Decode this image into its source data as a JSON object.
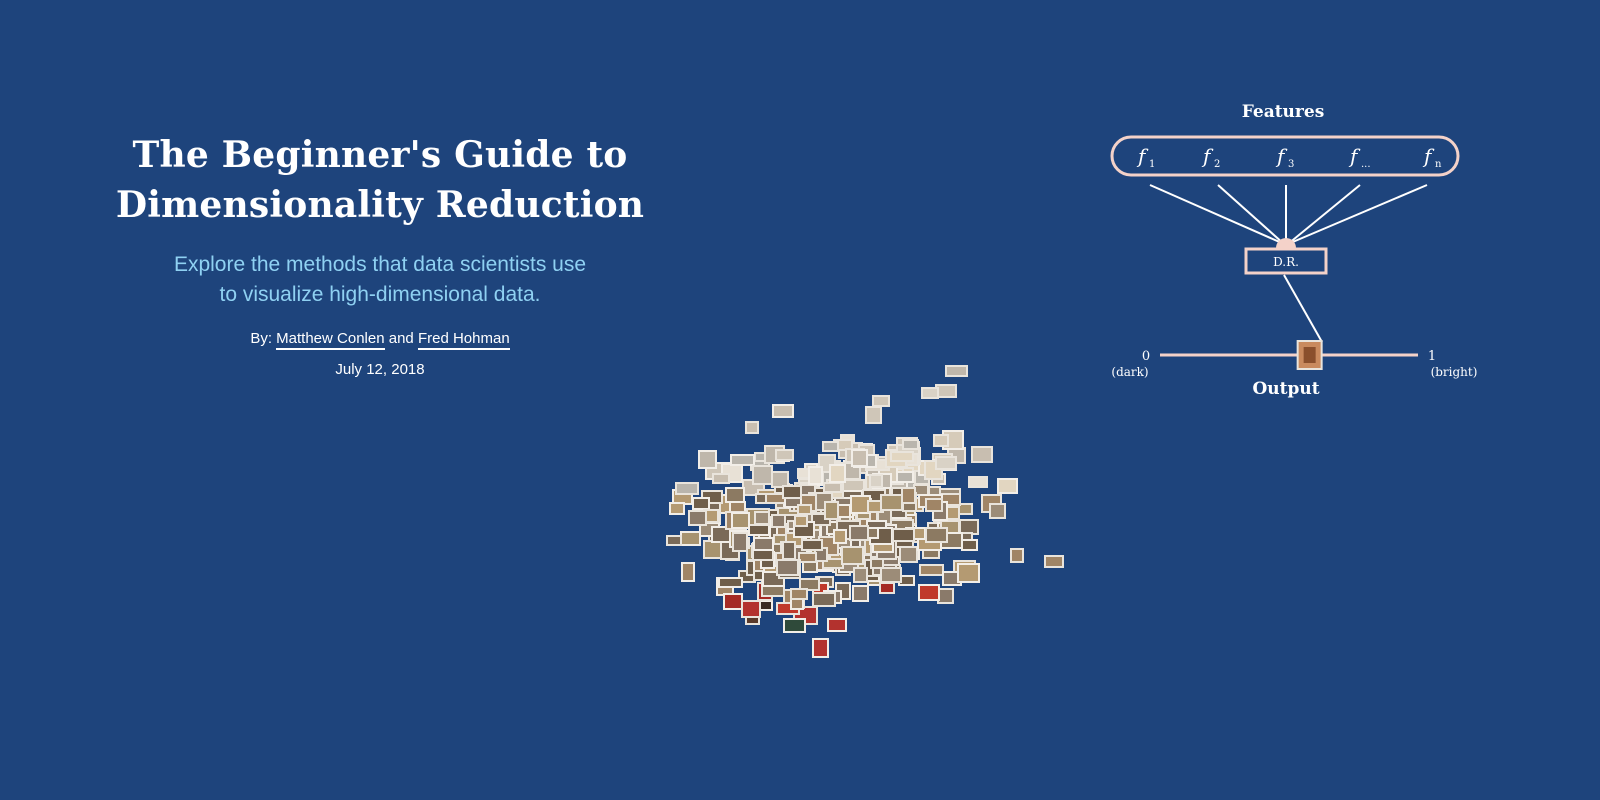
{
  "hero": {
    "title_line1": "The Beginner's Guide to",
    "title_line2": "Dimensionality Reduction",
    "subtitle_line1": "Explore the methods that data scientists use",
    "subtitle_line2": "to visualize high-dimensional data.",
    "by_label": "By:",
    "author1": "Matthew Conlen",
    "and_label": "and",
    "author2": "Fred Hohman",
    "date": "July 12, 2018"
  },
  "diagram": {
    "features_label": "Features",
    "features": [
      "f",
      "f",
      "f",
      "f",
      "f"
    ],
    "feature_subscripts": [
      "1",
      "2",
      "3",
      "...",
      "n"
    ],
    "dr_label": "D.R.",
    "output_label": "Output",
    "scale_min": "0",
    "scale_min_caption": "(dark)",
    "scale_max": "1",
    "scale_max_caption": "(bright)",
    "output_value": 0.58
  },
  "colors": {
    "background": "#1e447c",
    "subtitle": "#8fd1f2",
    "diagram_stroke": "#f4d2c9",
    "text": "#ffffff"
  }
}
